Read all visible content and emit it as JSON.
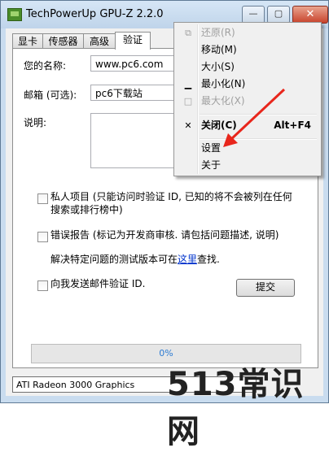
{
  "window": {
    "title": "TechPowerUp GPU-Z 2.2.0"
  },
  "tabs": [
    {
      "label": "显卡"
    },
    {
      "label": "传感器"
    },
    {
      "label": "高级"
    },
    {
      "label": "验证"
    }
  ],
  "form": {
    "name_label": "您的名称:",
    "name_value": "www.pc6.com",
    "email_label": "邮箱 (可选):",
    "email_value": "pc6下载站",
    "desc_label": "说明:"
  },
  "options": {
    "private_label": "私人项目 (只能访问时验证 ID, 已知的将不会被列在任何",
    "private_label2": "搜索或排行榜中)",
    "bug_label": "错误报告 (标记为开发商审核. 请包括问题描述, 说明)",
    "bug_note_before": "解决特定问题的测试版本可在",
    "bug_note_link": "这里",
    "bug_note_after": "查找.",
    "email_me_label": "向我发送邮件验证 ID."
  },
  "submit_button": "提交",
  "progress": {
    "text": "0%",
    "value": 0
  },
  "gpu_select": "ATI Radeon 3000 Graphics",
  "context_menu": {
    "restore": "还原(R)",
    "move": "移动(M)",
    "size": "大小(S)",
    "minimize": "最小化(N)",
    "maximize": "最大化(X)",
    "close": "关闭(C)",
    "close_shortcut": "Alt+F4",
    "settings": "设置",
    "about": "关于"
  },
  "watermark": "513常识网",
  "colors": {
    "annotation_arrow": "#e8261c",
    "accent": "#2c7bd3"
  }
}
